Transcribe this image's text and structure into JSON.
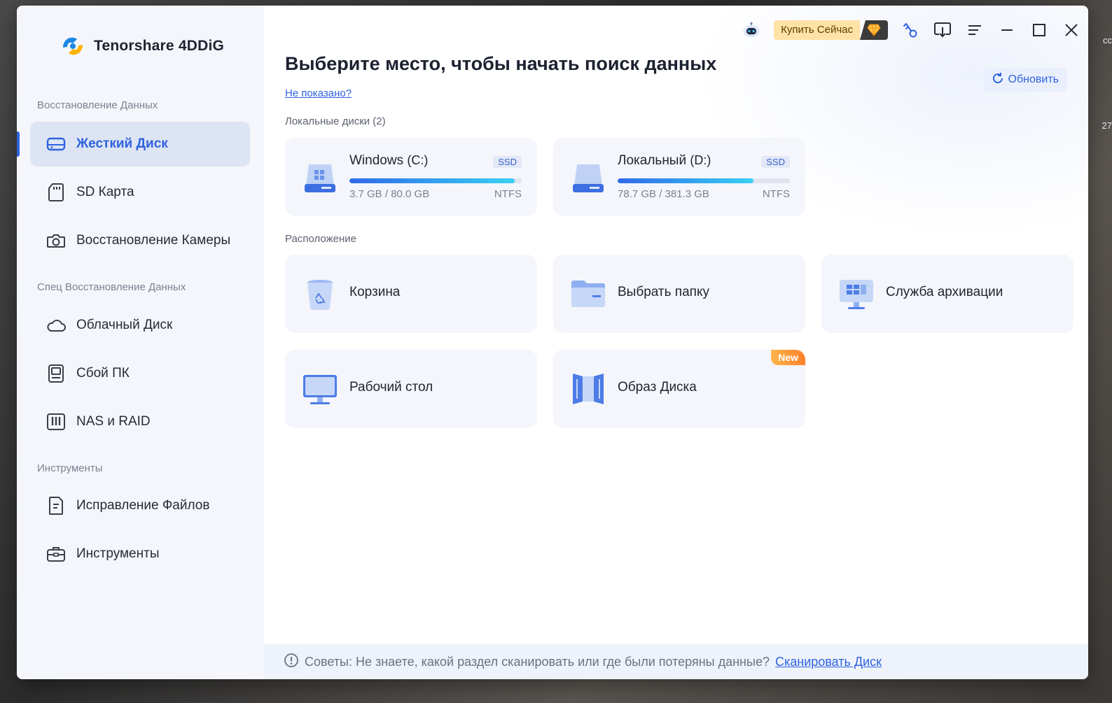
{
  "app": {
    "brand_name": "Tenorshare 4DDiG"
  },
  "sidebar": {
    "sections": [
      {
        "title": "Восстановление Данных"
      },
      {
        "title": "Спец Восстановление Данных"
      },
      {
        "title": "Инструменты"
      }
    ],
    "items": [
      {
        "label": "Жесткий Диск",
        "icon": "hard-drive-icon",
        "active": true
      },
      {
        "label": "SD Карта",
        "icon": "sd-card-icon"
      },
      {
        "label": "Восстановление Камеры",
        "icon": "camera-icon"
      },
      {
        "label": "Облачный Диск",
        "icon": "cloud-icon"
      },
      {
        "label": "Сбой ПК",
        "icon": "pc-crash-icon"
      },
      {
        "label": "NAS и RAID",
        "icon": "nas-raid-icon"
      },
      {
        "label": "Исправление Файлов",
        "icon": "file-repair-icon"
      },
      {
        "label": "Инструменты",
        "icon": "toolbox-icon"
      }
    ]
  },
  "topbar": {
    "buy_label": "Купить Сейчас",
    "icons": [
      "robot-assistant-icon",
      "diamond-icon",
      "key-icon",
      "download-icon",
      "menu-icon",
      "minimize-icon",
      "maximize-icon",
      "close-icon"
    ]
  },
  "main": {
    "title": "Выберите место, чтобы начать поиск данных",
    "not_shown": "Не показано?",
    "refresh_label": "Обновить",
    "local_disks_label": "Локальные диски (2)",
    "location_label": "Расположение"
  },
  "disks": [
    {
      "name": "Windows",
      "drive": "(C:)",
      "badge": "SSD",
      "size": "3.7 GB / 80.0 GB",
      "fs": "NTFS",
      "used_fraction": 0.96
    },
    {
      "name": "Локальный",
      "drive": "(D:)",
      "badge": "SSD",
      "size": "78.7 GB / 381.3 GB",
      "fs": "NTFS",
      "used_fraction": 0.79
    }
  ],
  "locations": [
    {
      "label": "Корзина",
      "icon": "recycle-bin-icon"
    },
    {
      "label": "Выбрать папку",
      "icon": "folder-icon"
    },
    {
      "label": "Служба архивации",
      "icon": "backup-service-icon"
    },
    {
      "label": "Рабочий стол",
      "icon": "desktop-icon"
    },
    {
      "label": "Образ Диска",
      "icon": "disk-image-icon",
      "badge": "New"
    }
  ],
  "tip": {
    "text": "Советы: Не знаете, какой раздел сканировать или где были потеряны данные?",
    "link": "Сканировать Диск"
  },
  "desktop": {
    "right_texts": [
      "cc",
      "27"
    ]
  },
  "colors": {
    "accent": "#2f63e0",
    "sidebar_bg": "#f4f6fb",
    "card_bg": "#f4f6fb",
    "new_badge": "#ff8f2f"
  }
}
